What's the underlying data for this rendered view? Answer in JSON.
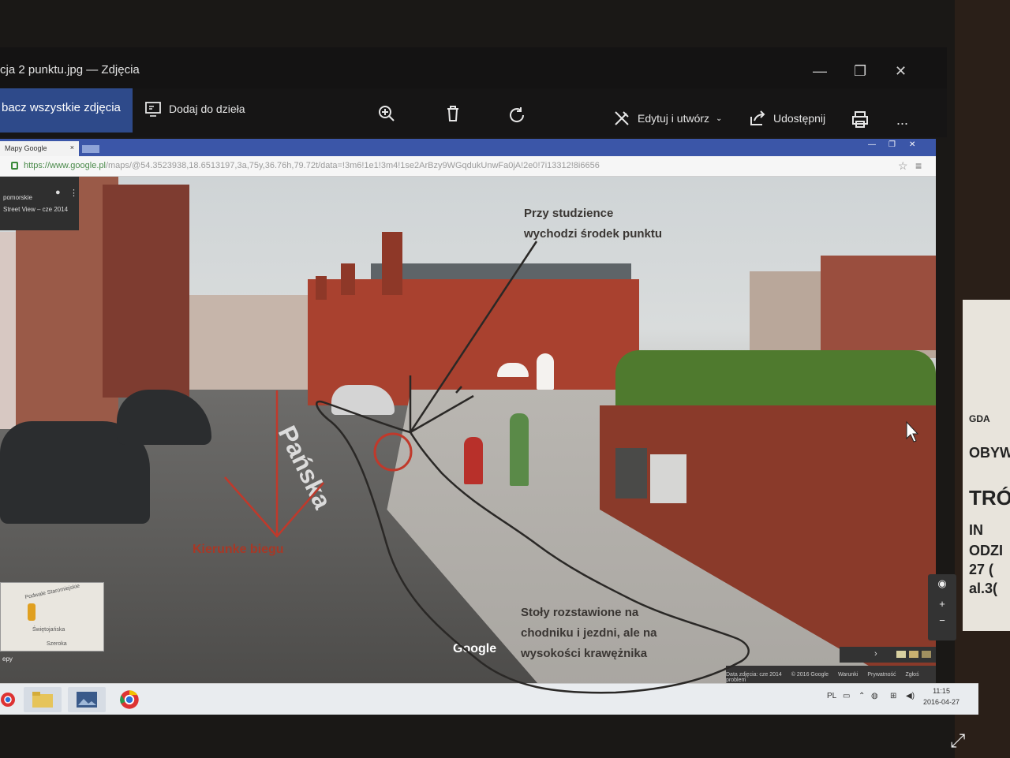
{
  "window": {
    "title": "cja 2 punktu.jpg — Zdjęcia",
    "controls": [
      "—",
      "❐",
      "✕"
    ]
  },
  "toolbar": {
    "see_all": "bacz wszystkie zdjęcia",
    "add_to_creation": "Dodaj do dzieła",
    "edit_create": "Edytuj i utwórz",
    "share": "Udostępnij",
    "more": "..."
  },
  "browser": {
    "tab_title": "Mapy Google",
    "tab_close": "×",
    "url_host": "https://www.google.pl",
    "url_rest": "/maps/@54.3523938,18.6513197,3a,75y,36.76h,79.72t/data=!3m6!1e1!3m4!1se2ArBzy9WGqdukUnwFa0jA!2e0!7i13312!8i6656",
    "window_controls": [
      "—",
      "❐",
      "✕"
    ]
  },
  "maps": {
    "location_line1": "pomorskie",
    "location_line2": "Street View – cze 2014",
    "minimap_streets": [
      "Podwale Staromiejskie",
      "Świętojańska",
      "Szeroka"
    ],
    "minimap_label": "epy",
    "google_logo": "Google",
    "attribution": [
      "Data zdjęcia: cze 2014",
      "© 2016 Google",
      "Warunki",
      "Prywatność",
      "Zgłoś problem"
    ]
  },
  "scene": {
    "street_name": "Pańska"
  },
  "annotations": {
    "note_top_line1": "Przy studzience",
    "note_top_line2": "wychodzi środek punktu",
    "direction_label": "Kierunke biegu",
    "note_bottom_line1": "Stoły rozstawione na",
    "note_bottom_line2": "chodniku i jezdni, ale na",
    "note_bottom_line3": "wysokości krawężnika"
  },
  "taskbar": {
    "lang": "PL",
    "time": "11:15",
    "date": "2016-04-27"
  },
  "poster": {
    "lines": [
      "GDA",
      "OBYW",
      "TRÓ",
      "IN",
      "ODZI",
      "27 (",
      "al.3("
    ]
  },
  "colors": {
    "accent_blue": "#2e4a8a",
    "annotation_red": "#c0392b",
    "annotation_line": "#2a2826"
  }
}
